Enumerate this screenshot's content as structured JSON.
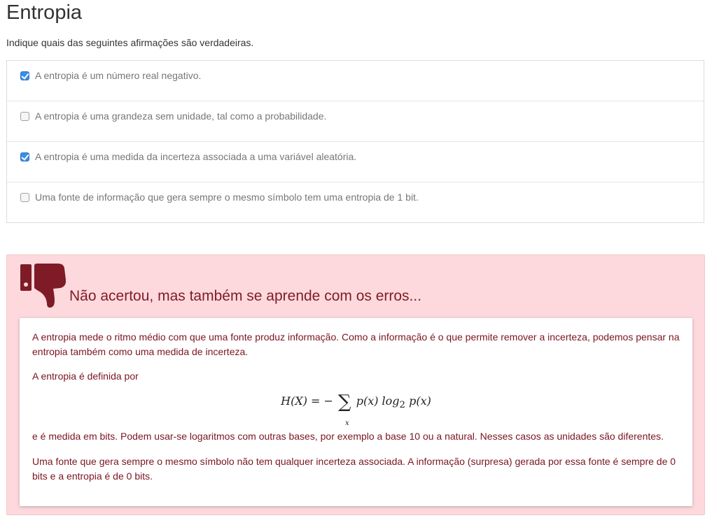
{
  "page": {
    "title": "Entropia",
    "instructions": "Indique quais das seguintes afirmações são verdadeiras."
  },
  "options": [
    {
      "label": "A entropia é um número real negativo.",
      "checked": true
    },
    {
      "label": "A entropia é uma grandeza sem unidade, tal como a probabilidade.",
      "checked": false
    },
    {
      "label": "A entropia é uma medida da incerteza associada a uma variável aleatória.",
      "checked": true
    },
    {
      "label": "Uma fonte de informação que gera sempre o mesmo símbolo tem uma entropia de 1 bit.",
      "checked": false
    }
  ],
  "feedback": {
    "icon": "thumbs-down-icon",
    "title": "Não acertou, mas também se aprende com os erros...",
    "paragraph1": "A entropia mede o ritmo médio com que uma fonte produz informação. Como a informação é o que permite remover a incerteza, podemos pensar na entropia também como uma medida de incerteza.",
    "paragraph2": "A entropia é definida por",
    "formula": {
      "lhs": "H(X) = −",
      "sum": "∑",
      "sum_index": "x",
      "rhs_pre": "p(x) log",
      "log_base": "2",
      "rhs_post": " p(x)"
    },
    "paragraph3": "e é medida em bits. Podem usar-se logaritmos com outras bases, por exemplo a base 10 ou a natural. Nesses casos as unidades são diferentes.",
    "paragraph4": "Uma fonte que gera sempre o mesmo símbolo não tem qualquer incerteza associada. A informação (surpresa) gerada por essa fonte é sempre de 0 bits e a entropia é de 0 bits."
  },
  "colors": {
    "feedback_bg": "#fdd9dd",
    "feedback_text": "#7a1520",
    "checkbox_checked": "#3a8ee6"
  }
}
